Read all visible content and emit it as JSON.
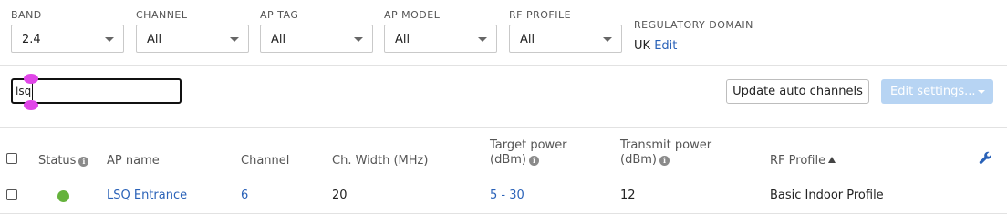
{
  "filters": [
    {
      "id": "band",
      "label": "BAND",
      "value": "2.4"
    },
    {
      "id": "channel",
      "label": "CHANNEL",
      "value": "All"
    },
    {
      "id": "ap_tag",
      "label": "AP TAG",
      "value": "All"
    },
    {
      "id": "ap_model",
      "label": "AP MODEL",
      "value": "All"
    },
    {
      "id": "rf_profile",
      "label": "RF PROFILE",
      "value": "All"
    }
  ],
  "regulatory": {
    "label": "REGULATORY DOMAIN",
    "value": "UK",
    "edit_label": "Edit"
  },
  "search": {
    "value": "lsq"
  },
  "toolbar": {
    "update_label": "Update auto channels",
    "edit_label": "Edit settings..."
  },
  "table": {
    "columns": {
      "status": "Status",
      "ap_name": "AP name",
      "channel": "Channel",
      "width": "Ch. Width (MHz)",
      "target_power_l1": "Target power",
      "target_power_l2": "(dBm)",
      "transmit_power_l1": "Transmit power",
      "transmit_power_l2": "(dBm)",
      "rf_profile": "RF Profile"
    },
    "rows": [
      {
        "status": "online",
        "ap_name": "LSQ Entrance",
        "channel": "6",
        "width": "20",
        "target_power": "5 - 30",
        "transmit_power": "12",
        "rf_profile": "Basic Indoor Profile"
      }
    ]
  },
  "icons": {
    "info": "info-icon",
    "sort": "sort-ascending-icon",
    "settings": "wrench-icon"
  },
  "colors": {
    "link": "#2a62b8",
    "status_online": "#65b23c",
    "primary_disabled": "#b7d4f3"
  }
}
